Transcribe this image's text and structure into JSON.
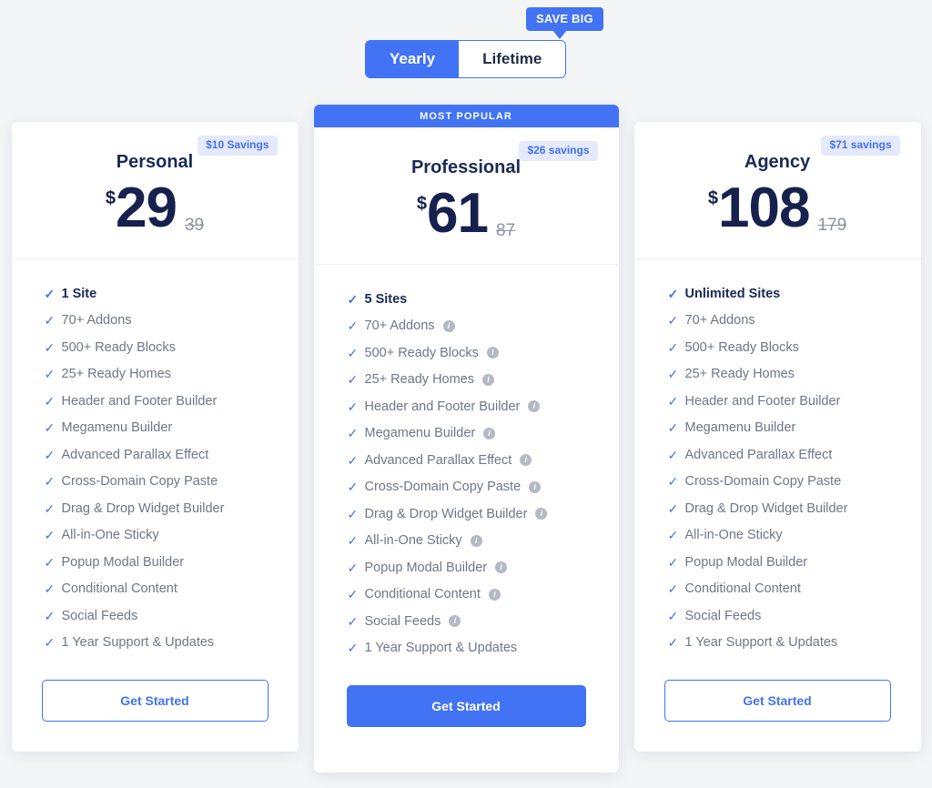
{
  "promo": {
    "badge_label": "SAVE BIG"
  },
  "billing_toggle": {
    "options": [
      {
        "label": "Yearly",
        "active": true
      },
      {
        "label": "Lifetime",
        "active": false
      }
    ]
  },
  "colors": {
    "accent": "#4273f5",
    "price_navy": "#16214d",
    "plan_navy": "#192a56",
    "feature_grey": "#6e7687",
    "savings_bg": "#e4e9fb",
    "page_bg": "#f4f5f7",
    "info_icon_grey": "#b4b9c4"
  },
  "plans": [
    {
      "id": "personal",
      "ribbon": null,
      "savings_badge": "$10 Savings",
      "name": "Personal",
      "currency": "$",
      "price": "29",
      "old_price": "39",
      "cta_label": "Get Started",
      "cta_style": "outline",
      "features": [
        {
          "label": "1 Site",
          "info": false
        },
        {
          "label": "70+ Addons",
          "info": false
        },
        {
          "label": "500+ Ready Blocks",
          "info": false
        },
        {
          "label": "25+ Ready Homes",
          "info": false
        },
        {
          "label": "Header and Footer Builder",
          "info": false
        },
        {
          "label": "Megamenu Builder",
          "info": false
        },
        {
          "label": "Advanced Parallax Effect",
          "info": false
        },
        {
          "label": "Cross-Domain Copy Paste",
          "info": false
        },
        {
          "label": "Drag & Drop Widget Builder",
          "info": false
        },
        {
          "label": "All-in-One Sticky",
          "info": false
        },
        {
          "label": "Popup Modal Builder",
          "info": false
        },
        {
          "label": "Conditional Content",
          "info": false
        },
        {
          "label": "Social Feeds",
          "info": false
        },
        {
          "label": "1 Year Support & Updates",
          "info": false
        }
      ]
    },
    {
      "id": "professional",
      "ribbon": "MOST POPULAR",
      "savings_badge": "$26 savings",
      "name": "Professional",
      "currency": "$",
      "price": "61",
      "old_price": "87",
      "cta_label": "Get Started",
      "cta_style": "primary",
      "features": [
        {
          "label": "5 Sites",
          "info": false
        },
        {
          "label": "70+ Addons",
          "info": true
        },
        {
          "label": "500+ Ready Blocks",
          "info": true
        },
        {
          "label": "25+ Ready Homes",
          "info": true
        },
        {
          "label": "Header and Footer Builder",
          "info": true
        },
        {
          "label": "Megamenu Builder",
          "info": true
        },
        {
          "label": "Advanced Parallax Effect",
          "info": true
        },
        {
          "label": "Cross-Domain Copy Paste",
          "info": true
        },
        {
          "label": "Drag & Drop Widget Builder",
          "info": true
        },
        {
          "label": "All-in-One Sticky",
          "info": true
        },
        {
          "label": "Popup Modal Builder",
          "info": true
        },
        {
          "label": "Conditional Content",
          "info": true
        },
        {
          "label": "Social Feeds",
          "info": true
        },
        {
          "label": "1 Year Support & Updates",
          "info": false
        }
      ]
    },
    {
      "id": "agency",
      "ribbon": null,
      "savings_badge": "$71 savings",
      "name": "Agency",
      "currency": "$",
      "price": "108",
      "old_price": "179",
      "cta_label": "Get Started",
      "cta_style": "outline",
      "features": [
        {
          "label": "Unlimited Sites",
          "info": false
        },
        {
          "label": "70+ Addons",
          "info": false
        },
        {
          "label": "500+ Ready Blocks",
          "info": false
        },
        {
          "label": "25+ Ready Homes",
          "info": false
        },
        {
          "label": "Header and Footer Builder",
          "info": false
        },
        {
          "label": "Megamenu Builder",
          "info": false
        },
        {
          "label": "Advanced Parallax Effect",
          "info": false
        },
        {
          "label": "Cross-Domain Copy Paste",
          "info": false
        },
        {
          "label": "Drag & Drop Widget Builder",
          "info": false
        },
        {
          "label": "All-in-One Sticky",
          "info": false
        },
        {
          "label": "Popup Modal Builder",
          "info": false
        },
        {
          "label": "Conditional Content",
          "info": false
        },
        {
          "label": "Social Feeds",
          "info": false
        },
        {
          "label": "1 Year Support & Updates",
          "info": false
        }
      ]
    }
  ],
  "icons": {
    "check": "✓",
    "info": "i"
  }
}
